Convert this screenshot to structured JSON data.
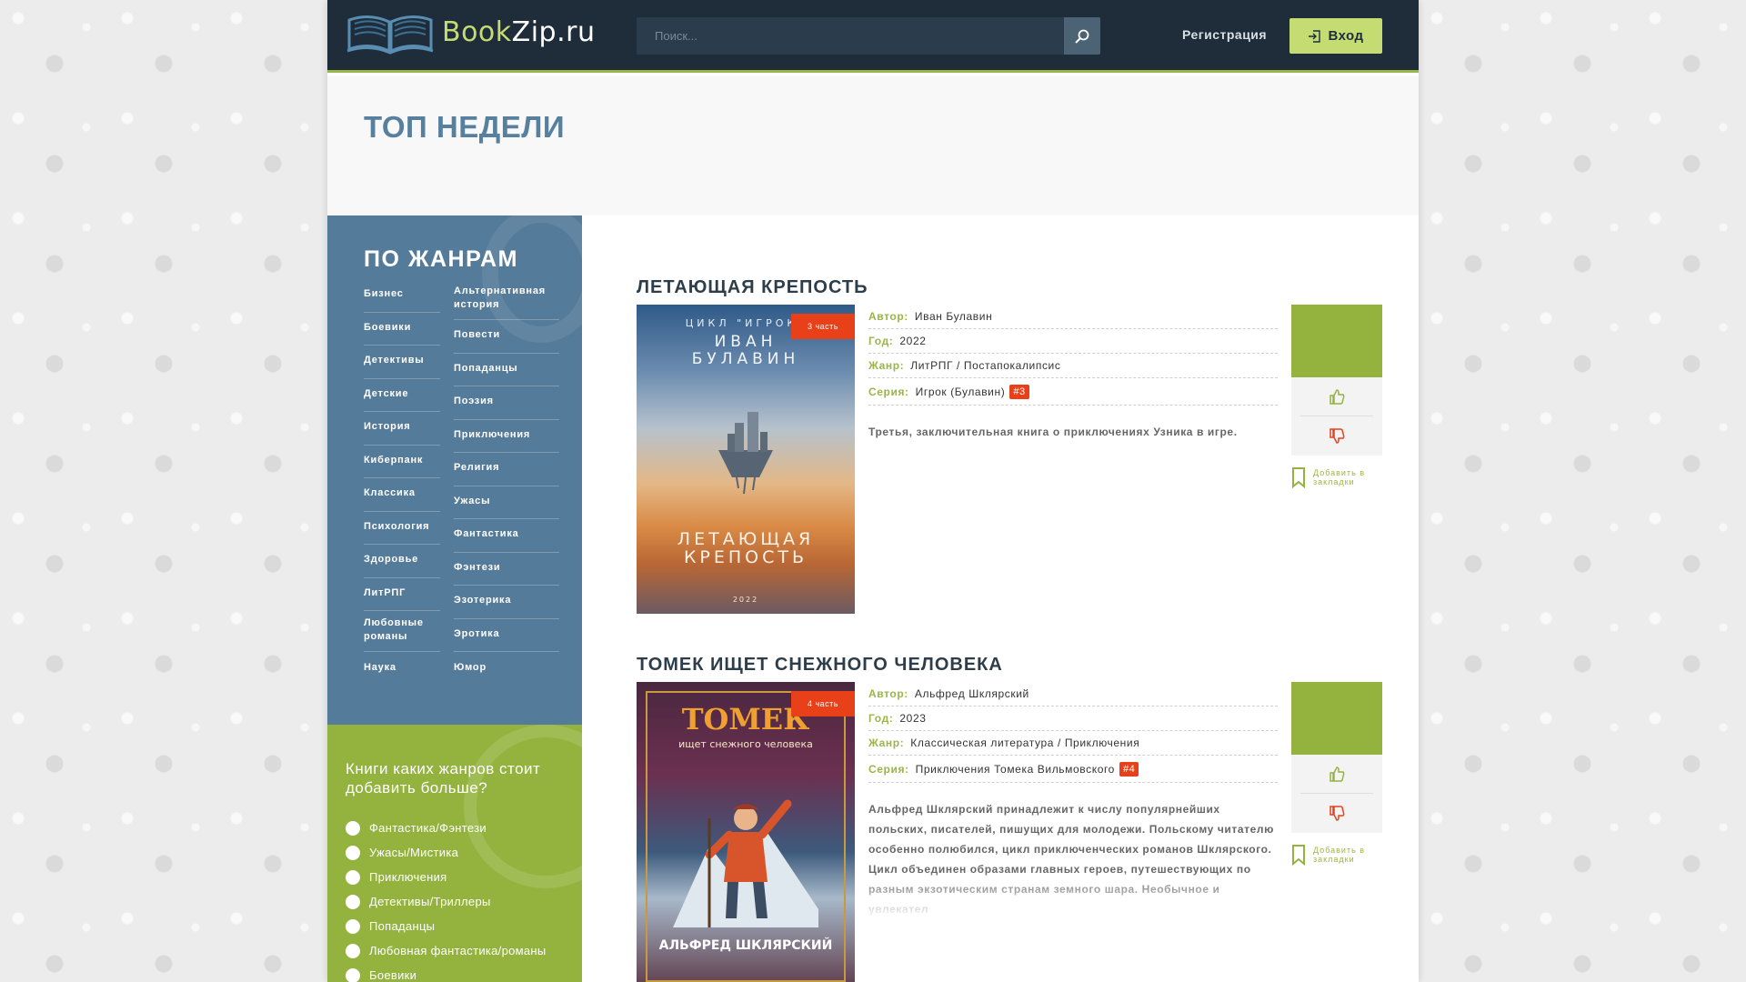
{
  "header": {
    "logo_part1": "Book",
    "logo_part2": "Zip.ru",
    "search_placeholder": "Поиск...",
    "register_label": "Регистрация",
    "login_label": "Вход"
  },
  "top": {
    "title": "ТОП НЕДЕЛИ"
  },
  "genres": {
    "title": "ПО ЖАНРАМ",
    "col1": [
      "Бизнес",
      "Боевики",
      "Детективы",
      "Детские",
      "История",
      "Киберпанк",
      "Классика",
      "Психология",
      "Здоровье",
      "ЛитРПГ",
      "Любовные романы",
      "Наука"
    ],
    "col2": [
      "Альтернативная история",
      "Повести",
      "Попаданцы",
      "Поэзия",
      "Приключения",
      "Религия",
      "Ужасы",
      "Фантастика",
      "Фэнтези",
      "Эзотерика",
      "Эротика",
      "Юмор"
    ]
  },
  "poll": {
    "title": "Книги каких жанров стоит добавить больше?",
    "options": [
      "Фантастика/Фэнтези",
      "Ужасы/Мистика",
      "Приключения",
      "Детективы/Триллеры",
      "Попаданцы",
      "Любовная фантастика/романы",
      "Боевики"
    ]
  },
  "books": [
    {
      "title": "ЛЕТАЮЩАЯ КРЕПОСТЬ",
      "badge": "3 часть",
      "cover": {
        "top": "ЦИКЛ \"ИГРОК\"",
        "author": "ИВАН\nБУЛАВИН",
        "name": "ЛЕТАЮЩАЯ\nКРЕПОСТЬ",
        "year": "2022"
      },
      "author_label": "Автор:",
      "author": "Иван Булавин",
      "year_label": "Год:",
      "year": "2022",
      "genre_label": "Жанр:",
      "genre": "ЛитРПГ / Постапокалипсис",
      "series_label": "Серия:",
      "series": "Игрок (Булавин)",
      "series_num": "#3",
      "description": "Третья, заключительная книга о приключениях Узника в игре.",
      "bookmark": "Добавить в закладки"
    },
    {
      "title": "ТОМЕК ИЩЕТ СНЕЖНОГО ЧЕЛОВЕКА",
      "badge": "4 часть",
      "cover": {
        "top": "ТОМЕК",
        "sub": "ищет снежного человека",
        "author": "АЛЬФРЕД ШКЛЯРСКИЙ"
      },
      "author_label": "Автор:",
      "author": "Альфред Шклярский",
      "year_label": "Год:",
      "year": "2023",
      "genre_label": "Жанр:",
      "genre": "Классическая литература / Приключения",
      "series_label": "Серия:",
      "series": "Приключения Томека Вильмовского",
      "series_num": "#4",
      "description": "Альфред Шклярский принадлежит к числу популярнейших польских, писателей, пишущих для молодежи. Польскому читателю особенно полюбился, цикл приключенческих романов Шклярского. Цикл объединен образами главных героев, путешествующих по разным экзотическим странам земного шара. Необычное и увлекател",
      "bookmark": "Добавить в закладки"
    }
  ],
  "colors": {
    "header_bg": "#1f2d3a",
    "accent_green": "#9ab646",
    "sidebar_blue": "#557b9a",
    "poll_green": "#93b33e",
    "badge_red": "#e8411a"
  }
}
